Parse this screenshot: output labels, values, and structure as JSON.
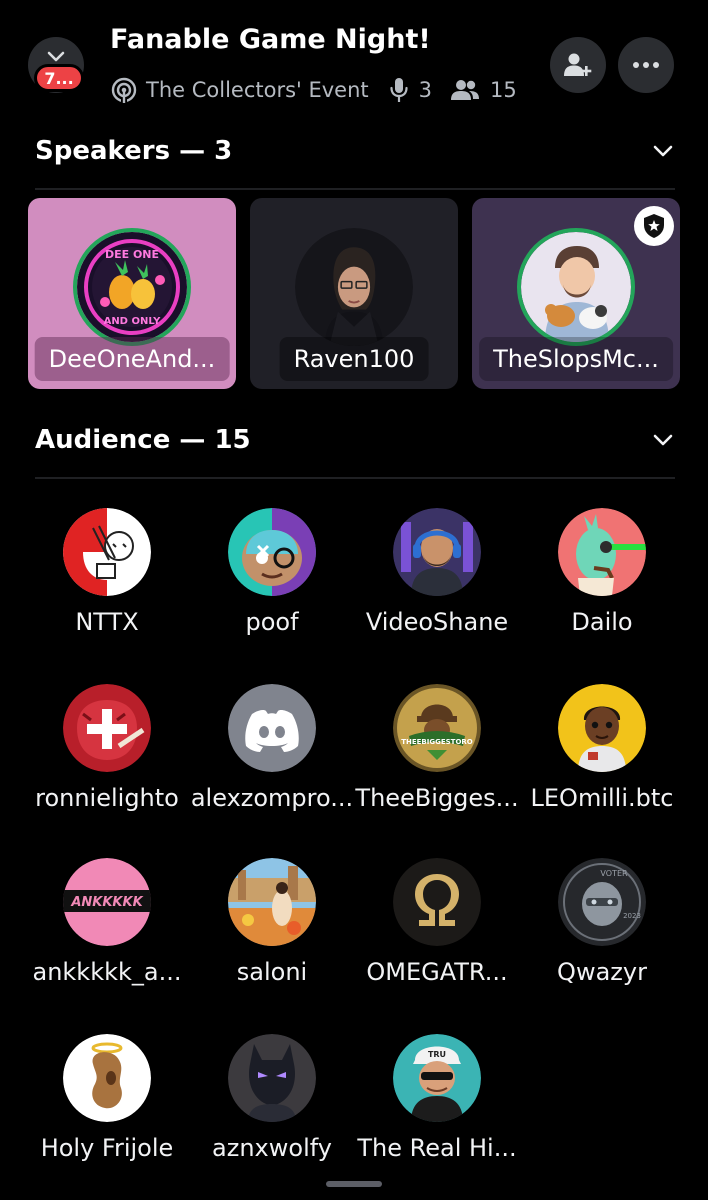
{
  "header": {
    "title": "Fanable Game Night!",
    "unread_badge": "7...",
    "event_name": "The Collectors' Event",
    "speaker_count": "3",
    "listener_count": "15"
  },
  "speakers": {
    "heading": "Speakers — 3",
    "items": [
      {
        "name": "DeeOneAnd...",
        "tile_color": "#d18dbf",
        "avatar_text_top": "DEE ONE",
        "avatar_text_bottom": "AND ONLY"
      },
      {
        "name": "Raven100",
        "tile_color": "#202027"
      },
      {
        "name": "TheSlopsMc...",
        "tile_color": "#3e3250"
      }
    ]
  },
  "audience": {
    "heading": "Audience — 15",
    "items": [
      {
        "name": "NTTX"
      },
      {
        "name": "poof"
      },
      {
        "name": "VideoShane"
      },
      {
        "name": "Dailo"
      },
      {
        "name": "ronnielighto"
      },
      {
        "name": "alexzompro..."
      },
      {
        "name": "TheeBigges...",
        "avatar_text": "THEEBIGGESTORO"
      },
      {
        "name": "LEOmilli.btc"
      },
      {
        "name": "ankkkkk_a...",
        "avatar_text": "ANKKKKK"
      },
      {
        "name": "saloni"
      },
      {
        "name": "OMEGATR..."
      },
      {
        "name": "Qwazyr",
        "avatar_text_top": "VOTER",
        "avatar_text_bottom": "2023"
      },
      {
        "name": "Holy Frijole"
      },
      {
        "name": "aznxwolfy"
      },
      {
        "name": "The Real Hi...",
        "avatar_text": "TRU"
      }
    ]
  },
  "icons": {
    "back": "chevron-down-icon",
    "event": "stage-icon",
    "mic": "microphone-icon",
    "people": "people-icon",
    "invite": "add-friend-icon",
    "more": "more-icon",
    "collapse": "chevron-down-icon",
    "moderator": "shield-star-icon"
  },
  "colors": {
    "background": "#000000",
    "speaking_ring": "#23a55a",
    "badge": "#ed4245"
  }
}
